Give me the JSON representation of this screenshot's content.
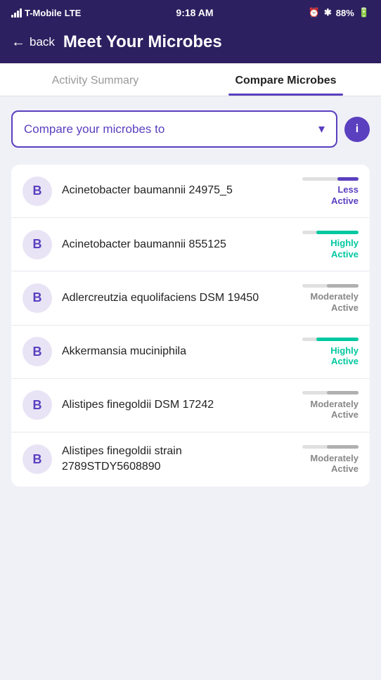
{
  "statusBar": {
    "carrier": "T-Mobile",
    "networkType": "LTE",
    "time": "9:18 AM",
    "battery": "88%"
  },
  "header": {
    "backLabel": "back",
    "title": "Meet Your Microbes"
  },
  "tabs": [
    {
      "id": "activity-summary",
      "label": "Activity Summary",
      "active": false
    },
    {
      "id": "compare-microbes",
      "label": "Compare Microbes",
      "active": true
    }
  ],
  "dropdown": {
    "placeholder": "Compare your microbes to",
    "infoLabel": "i"
  },
  "microbes": [
    {
      "avatar": "B",
      "name": "Acinetobacter baumannii 24975_5",
      "activityLevel": "less",
      "activityLabel": "Less\nActive"
    },
    {
      "avatar": "B",
      "name": "Acinetobacter baumannii 855125",
      "activityLevel": "high",
      "activityLabel": "Highly\nActive"
    },
    {
      "avatar": "B",
      "name": "Adlercreutzia equolifaciens DSM 19450",
      "activityLevel": "moderate",
      "activityLabel": "Moderately\nActive"
    },
    {
      "avatar": "B",
      "name": "Akkermansia muciniphila",
      "activityLevel": "high",
      "activityLabel": "Highly\nActive"
    },
    {
      "avatar": "B",
      "name": "Alistipes finegoldii DSM 17242",
      "activityLevel": "moderate",
      "activityLabel": "Moderately\nActive"
    },
    {
      "avatar": "B",
      "name": "Alistipes finegoldii strain 2789STDY5608890",
      "activityLevel": "moderate",
      "activityLabel": "Moderately\nActive"
    }
  ]
}
